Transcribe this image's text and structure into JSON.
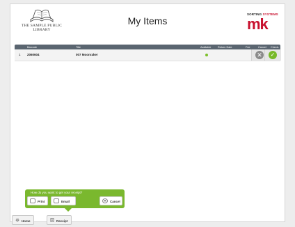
{
  "header": {
    "library_name_line1": "THE SAMPLE PUBLIC",
    "library_name_line2": "LIBRARY",
    "title": "My Items",
    "vendor_tagline_part1": "SORTING ",
    "vendor_tagline_part2": "SYSTEMS",
    "vendor_logo_letters": "mk"
  },
  "table": {
    "columns": [
      "Barcode",
      "Title",
      "Available",
      "Return Date",
      "Fee",
      "Cancel",
      "Check-out"
    ],
    "rows": [
      {
        "index": "1",
        "barcode": "2060604",
        "title": "007 Moonraker",
        "available": true,
        "return_date": "",
        "fee": ""
      }
    ]
  },
  "receipt_popup": {
    "question": "How do you want to get your receipt?",
    "print_label": "Print",
    "email_label": "Email",
    "cancel_label": "Cancel"
  },
  "nav": {
    "home_label": "Home",
    "receipt_label": "Receipt"
  },
  "colors": {
    "accent_green": "#7ab82e",
    "brand_red": "#c8102e",
    "header_bar": "#5a6570"
  }
}
